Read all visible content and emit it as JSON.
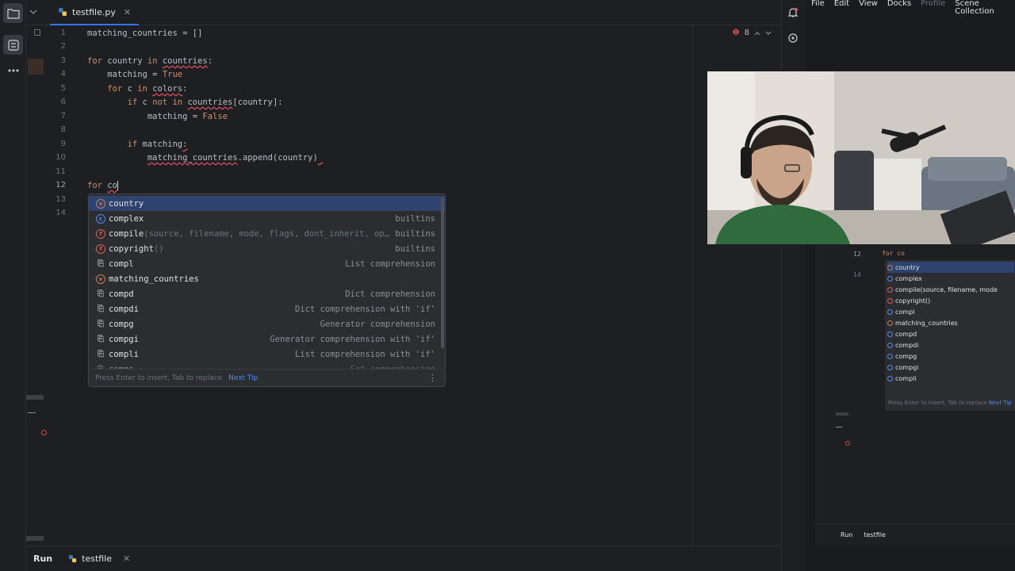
{
  "tab": {
    "filename": "testfile.py",
    "close": "✕"
  },
  "editor": {
    "line_numbers": [
      "1",
      "2",
      "3",
      "4",
      "5",
      "6",
      "7",
      "8",
      "9",
      "10",
      "11",
      "12",
      "13",
      "14"
    ],
    "lines": [
      "matching_countries = []",
      "",
      "for country in countries:",
      "    matching = True",
      "    for c in colors:",
      "        if c not in countries[country]:",
      "            matching = False",
      "",
      "        if matching:",
      "            matching_countries.append(country)",
      "",
      "for co",
      "",
      ""
    ],
    "error_count": "8",
    "error_glyph": "❶"
  },
  "autocomplete": {
    "items": [
      {
        "icon": "v",
        "name": "country",
        "extra": "",
        "type": ""
      },
      {
        "icon": "c",
        "name": "complex",
        "extra": "",
        "type": "builtins"
      },
      {
        "icon": "f",
        "name": "compile",
        "extra": "(source, filename, mode, flags, dont_inherit, op…",
        "type": "builtins"
      },
      {
        "icon": "f",
        "name": "copyright",
        "extra": "()",
        "type": "builtins"
      },
      {
        "icon": "t",
        "name": "compl",
        "extra": "",
        "type": "List comprehension"
      },
      {
        "icon": "v",
        "name": "matching_countries",
        "extra": "",
        "type": ""
      },
      {
        "icon": "t",
        "name": "compd",
        "extra": "",
        "type": "Dict comprehension"
      },
      {
        "icon": "t",
        "name": "compdi",
        "extra": "",
        "type": "Dict comprehension with 'if'"
      },
      {
        "icon": "t",
        "name": "compg",
        "extra": "",
        "type": "Generator comprehension"
      },
      {
        "icon": "t",
        "name": "compgi",
        "extra": "",
        "type": "Generator comprehension with 'if'"
      },
      {
        "icon": "t",
        "name": "compli",
        "extra": "",
        "type": "List comprehension with 'if'"
      },
      {
        "icon": "t",
        "name": "comps",
        "extra": "",
        "type": "Set comprehension"
      }
    ],
    "footer_hint": "Press Enter to insert, Tab to replace",
    "footer_tip": "Next Tip"
  },
  "runbar": {
    "label": "Run",
    "tab": "testfile",
    "close": "✕"
  },
  "obs": {
    "menu": [
      "File",
      "Edit",
      "View",
      "Docks",
      "Profile",
      "Scene Collection"
    ],
    "preview_line12": "12",
    "preview_line14": "14",
    "preview_code": "for co",
    "preview_items": [
      "country",
      "complex",
      "compile(source, filename, mode",
      "copyright()",
      "compl",
      "matching_countries",
      "compd",
      "compdi",
      "compg",
      "compgi",
      "compli"
    ],
    "preview_footer": "Press Enter to insert, Tab to replace",
    "preview_tip": "Next Tip",
    "preview_run": "Run",
    "preview_tab": "testfile"
  },
  "colors": {
    "accent": "#3574f0",
    "selection": "#2e436e",
    "keyword": "#cf8e6d",
    "error": "#f75464"
  }
}
